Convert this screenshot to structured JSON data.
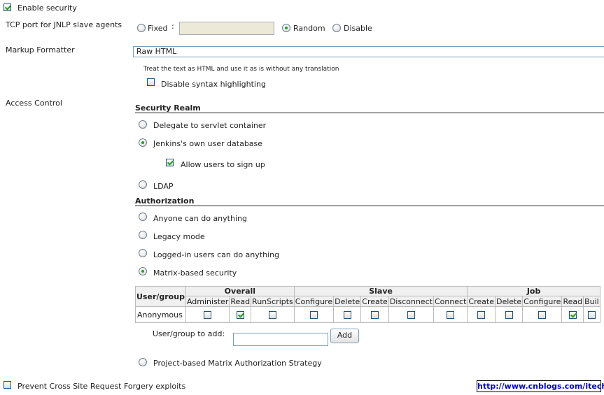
{
  "security": {
    "enable_label": "Enable security",
    "enable_checked": true
  },
  "tcp_port": {
    "label": "TCP port for JNLP slave agents",
    "fixed_label": "Fixed",
    "fixed_colon": ":",
    "fixed_value": "",
    "random_label": "Random",
    "disable_label": "Disable",
    "selected": "Random"
  },
  "markup": {
    "label": "Markup Formatter",
    "value": "Raw HTML",
    "description": "Treat the text as HTML and use it as is without any translation",
    "disable_syntax_label": "Disable syntax highlighting",
    "disable_syntax_checked": false
  },
  "access_control": {
    "label": "Access Control",
    "security_realm_title": "Security Realm",
    "realm_options": [
      "Delegate to servlet container",
      "Jenkins's own user database",
      "LDAP"
    ],
    "realm_selected": "Jenkins's own user database",
    "allow_signup_label": "Allow users to sign up",
    "allow_signup_checked": true,
    "authorization_title": "Authorization",
    "auth_options": [
      "Anyone can do anything",
      "Legacy mode",
      "Logged-in users can do anything",
      "Matrix-based security",
      "Project-based Matrix Authorization Strategy"
    ],
    "auth_selected": "Matrix-based security"
  },
  "matrix": {
    "user_group_header": "User/group",
    "groups": [
      {
        "name": "Overall",
        "permissions": [
          "Administer",
          "Read",
          "RunScripts"
        ]
      },
      {
        "name": "Slave",
        "permissions": [
          "Configure",
          "Delete",
          "Create",
          "Disconnect",
          "Connect"
        ]
      },
      {
        "name": "Job",
        "permissions": [
          "Create",
          "Delete",
          "Configure",
          "Read",
          "Buil"
        ]
      }
    ],
    "rows": [
      {
        "user": "Anonymous",
        "checked": [
          false,
          true,
          false,
          false,
          false,
          false,
          false,
          false,
          false,
          false,
          false,
          true,
          false
        ]
      }
    ],
    "add_label": "User/group to add:",
    "add_value": "",
    "add_button": "Add"
  },
  "csrf": {
    "label": "Prevent Cross Site Request Forgery exploits",
    "checked": false
  },
  "watermark": "http://www.cnblogs.com/itech"
}
